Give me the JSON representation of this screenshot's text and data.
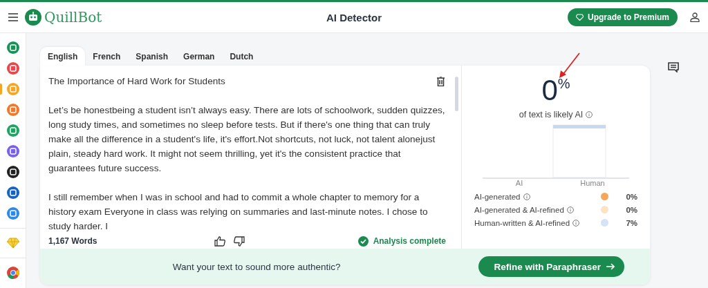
{
  "header": {
    "logo_text": "QuillBot",
    "title": "AI Detector",
    "upgrade_button": "Upgrade to Premium"
  },
  "sidebar": {
    "items": [
      {
        "color": "#17935a",
        "selected": false
      },
      {
        "color": "#e5484d",
        "selected": false
      },
      {
        "color": "#f5a623",
        "selected": true
      },
      {
        "color": "#f07a2a",
        "selected": false
      },
      {
        "color": "#1fa463",
        "selected": false
      },
      {
        "color": "#7b61e8",
        "selected": false
      },
      {
        "color": "#222222",
        "selected": false
      },
      {
        "color": "#1565c0",
        "selected": false
      },
      {
        "color": "#2e8ae6",
        "selected": false
      }
    ]
  },
  "tabs": [
    {
      "label": "English",
      "selected": true
    },
    {
      "label": "French",
      "selected": false
    },
    {
      "label": "Spanish",
      "selected": false
    },
    {
      "label": "German",
      "selected": false
    },
    {
      "label": "Dutch",
      "selected": false
    }
  ],
  "editor": {
    "paragraphs": [
      "The Importance of Hard Work for Students",
      "Let’s be honestbeing a student isn’t always easy. There are lots of schoolwork, sudden quizzes, long study times, and sometimes no sleep before tests. But if there's one thing that can truly make all the difference in a student's life, it's effort.Not shortcuts, not luck, not talent alonejust plain, steady hard work. It might not seem thrilling, yet it's the consistent practice that guarantees future success.",
      "I still remember when I was in school and had to commit a whole chapter to memory for a history exam Everyone in class was relying on summaries and last-minute notes. I chose to study harder. I"
    ],
    "word_count": "1,167 Words",
    "status": "Analysis complete"
  },
  "result": {
    "percent": "0",
    "percent_sign": "%",
    "caption": "of text is likely AI",
    "chart_labels": [
      "AI",
      "Human"
    ],
    "legend": [
      {
        "label": "AI-generated",
        "value": "0%",
        "color": "#f5a85a"
      },
      {
        "label": "AI-generated & AI-refined",
        "value": "0%",
        "color": "#fbe3c4"
      },
      {
        "label": "Human-written & AI-refined",
        "value": "7%",
        "color": "#d6e2f5"
      }
    ]
  },
  "banner": {
    "text": "Want your text to sound more authentic?",
    "button": "Refine with Paraphraser"
  }
}
